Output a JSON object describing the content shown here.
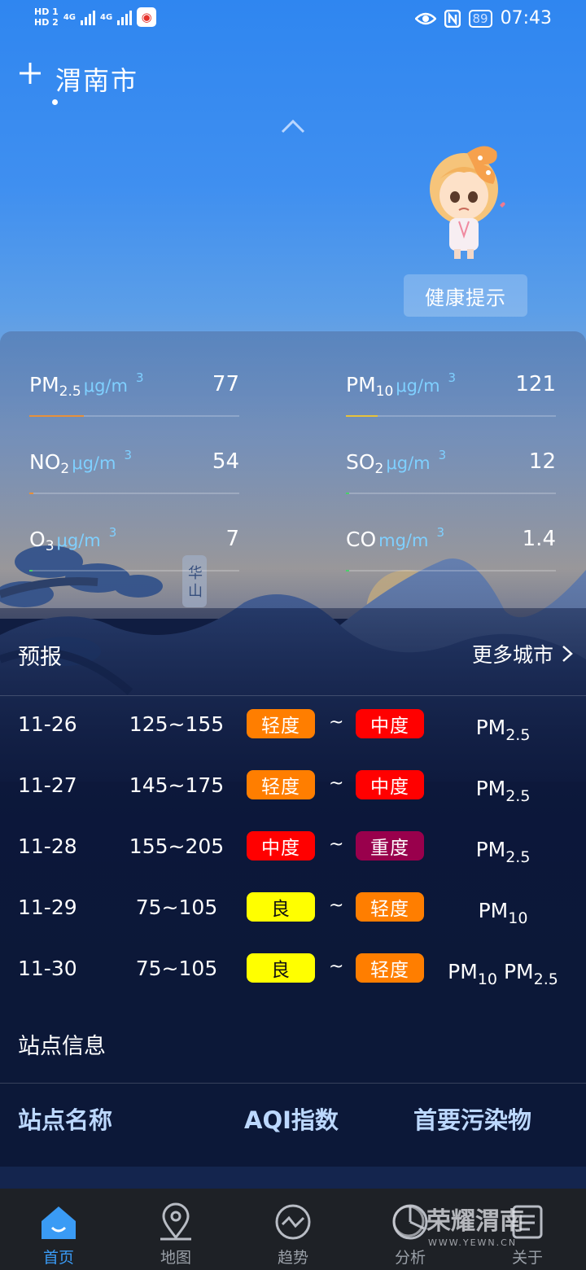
{
  "status_bar": {
    "hd1": "HD 1",
    "hd2": "HD 2",
    "net1": "4G",
    "net2": "4G",
    "battery": "89",
    "time": "07:43"
  },
  "header": {
    "city": "渭南市",
    "health_button": "健康提示"
  },
  "pollutants": [
    {
      "name": "PM",
      "sub": "2.5",
      "unit": "μg/m",
      "unit_sup": "3",
      "value": "77",
      "level": 0.26,
      "color": "#e8903a"
    },
    {
      "name": "PM",
      "sub": "10",
      "unit": "μg/m",
      "unit_sup": "3",
      "value": "121",
      "level": 0.15,
      "color": "#e8c23a"
    },
    {
      "name": "NO",
      "sub": "2",
      "unit": "μg/m",
      "unit_sup": "3",
      "value": "54",
      "level": 0.02,
      "color": "#e8903a"
    },
    {
      "name": "SO",
      "sub": "2",
      "unit": "μg/m",
      "unit_sup": "3",
      "value": "12",
      "level": 0.01,
      "color": "#4ad06a"
    },
    {
      "name": "O",
      "sub": "3",
      "unit": "μg/m",
      "unit_sup": "3",
      "value": "7",
      "level": 0.0,
      "color": "#4ad06a"
    },
    {
      "name": "CO",
      "sub": "",
      "unit": "mg/m",
      "unit_sup": "3",
      "value": "1.4",
      "level": 0.01,
      "color": "#4ad06a"
    }
  ],
  "scene_label": "华山",
  "forecast": {
    "title": "预报",
    "more": "更多城市",
    "tilde": "~",
    "rows": [
      {
        "date": "11-26",
        "range": "125~155",
        "from": "轻度",
        "from_color": "#ff7e00",
        "to": "中度",
        "to_color": "#ff0000",
        "p1": "PM",
        "p1_sub": "2.5",
        "p2": "",
        "p2_sub": ""
      },
      {
        "date": "11-27",
        "range": "145~175",
        "from": "轻度",
        "from_color": "#ff7e00",
        "to": "中度",
        "to_color": "#ff0000",
        "p1": "PM",
        "p1_sub": "2.5",
        "p2": "",
        "p2_sub": ""
      },
      {
        "date": "11-28",
        "range": "155~205",
        "from": "中度",
        "from_color": "#ff0000",
        "to": "重度",
        "to_color": "#99004c",
        "p1": "PM",
        "p1_sub": "2.5",
        "p2": "",
        "p2_sub": ""
      },
      {
        "date": "11-29",
        "range": "75~105",
        "from": "良",
        "from_color": "#ffff00",
        "to": "轻度",
        "to_color": "#ff7e00",
        "p1": "PM",
        "p1_sub": "10",
        "p2": "",
        "p2_sub": ""
      },
      {
        "date": "11-30",
        "range": "75~105",
        "from": "良",
        "from_color": "#ffff00",
        "to": "轻度",
        "to_color": "#ff7e00",
        "p1": "PM",
        "p1_sub": "10",
        "p2": "PM",
        "p2_sub": "2.5"
      }
    ]
  },
  "station": {
    "title": "站点信息",
    "col_name": "站点名称",
    "col_aqi": "AQI指数",
    "col_primary": "首要污染物"
  },
  "nav": [
    {
      "label": "首页",
      "icon": "home-icon"
    },
    {
      "label": "地图",
      "icon": "map-pin-icon"
    },
    {
      "label": "趋势",
      "icon": "trend-icon"
    },
    {
      "label": "分析",
      "icon": "analysis-icon"
    },
    {
      "label": "关于",
      "icon": "about-icon"
    }
  ],
  "watermark": {
    "brand": "荣耀渭南",
    "url": "WWW.YEWN.CN"
  }
}
